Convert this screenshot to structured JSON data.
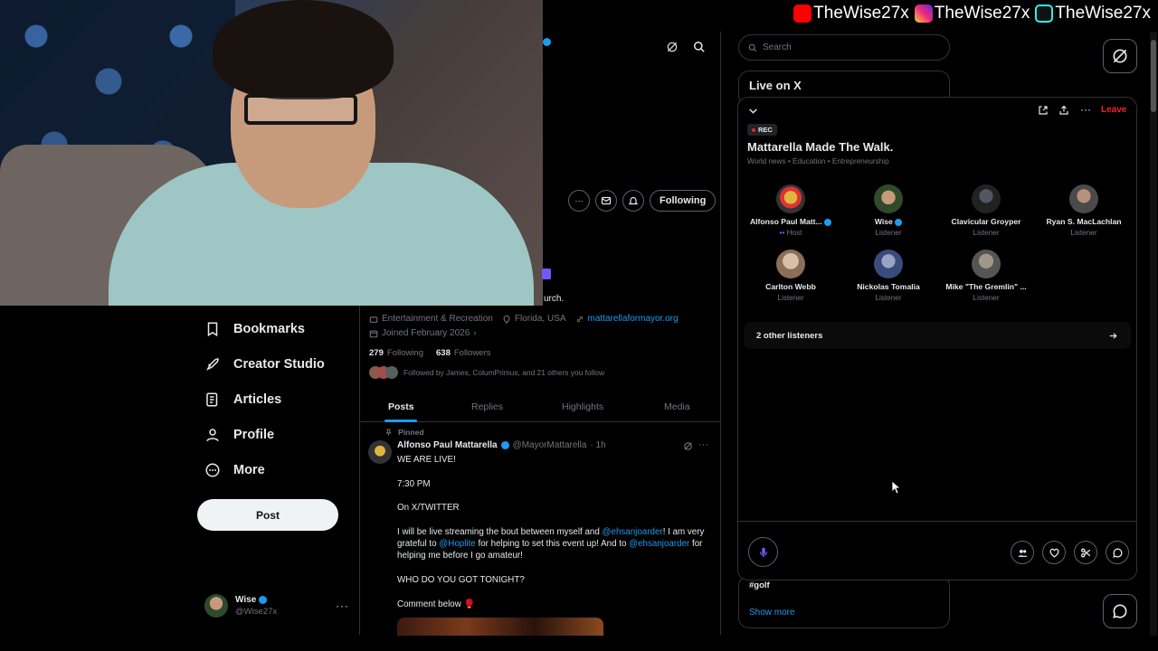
{
  "socials": [
    {
      "platform": "youtube",
      "handle": "TheWise27x",
      "icon": "youtube-icon",
      "color": "#ff0000"
    },
    {
      "platform": "instagram",
      "handle": "TheWise27x",
      "icon": "instagram-icon",
      "color": "#e1306c"
    },
    {
      "platform": "tiktok",
      "handle": "TheWise27x",
      "icon": "tiktok-icon",
      "color": "#25f4ee"
    }
  ],
  "nav": {
    "items": [
      {
        "label": "Bookmarks",
        "icon": "bookmark-icon"
      },
      {
        "label": "Creator Studio",
        "icon": "rocket-icon"
      },
      {
        "label": "Articles",
        "icon": "article-icon"
      },
      {
        "label": "Profile",
        "icon": "person-icon"
      },
      {
        "label": "More",
        "icon": "more-circle-icon"
      }
    ],
    "post_label": "Post"
  },
  "account": {
    "name": "Wise",
    "handle": "@Wise27x"
  },
  "profile": {
    "following_button": "Following",
    "bio_fragment": "urch.",
    "category": "Entertainment & Recreation",
    "location": "Florida, USA",
    "website": "mattarellaformayor.org",
    "joined": "Joined February 2026",
    "following_count": "279",
    "following_label": "Following",
    "followers_count": "638",
    "followers_label": "Followers",
    "followed_by": "Followed by James, ColumPrimus, and 21 others you follow",
    "tabs": [
      "Posts",
      "Replies",
      "Highlights",
      "Media"
    ],
    "active_tab": "Posts"
  },
  "pinned_post": {
    "pinned_label": "Pinned",
    "author": "Alfonso Paul Mattarella",
    "handle": "@MayorMattarella",
    "time": "· 1h",
    "line1": "WE ARE LIVE!",
    "line2": "7:30 PM",
    "line3": "On X/TWITTER",
    "body_a": "I will be live streaming the bout between myself and ",
    "mention1": "@ehsanjoarder",
    "body_b": "! I am very grateful to ",
    "mention2": "@Hoplite",
    "body_c": " for helping to set this event up! And to ",
    "mention3": "@ehsanjoarder",
    "body_d": " for helping me before I go amateur!",
    "line5": "WHO DO YOU GOT TONIGHT?",
    "line6": "Comment below 🥊"
  },
  "search": {
    "placeholder": "Search"
  },
  "live_card": {
    "title": "Live on X"
  },
  "trends": {
    "tag": "#golf",
    "show_more": "Show more"
  },
  "space": {
    "leave_label": "Leave",
    "rec_label": "REC",
    "title": "Mattarella Made The Walk.",
    "topics": "World news • Education • Entrepreneurship",
    "participants": [
      {
        "name": "Alfonso Paul Matt...",
        "role": "Host",
        "verified": true
      },
      {
        "name": "Wise",
        "role": "Listener",
        "verified": true
      },
      {
        "name": "Clavicular Groyper",
        "role": "Listener",
        "verified": false
      },
      {
        "name": "Ryan S. MacLachlan",
        "role": "Listener",
        "verified": false
      },
      {
        "name": "Carlton Webb",
        "role": "Listener",
        "verified": false
      },
      {
        "name": "Nickolas Tomalia",
        "role": "Listener",
        "verified": false
      },
      {
        "name": "Mike \"The Gremlin\" ...",
        "role": "Listener",
        "verified": false
      }
    ],
    "other_listeners": "2 other listeners"
  },
  "colors": {
    "accent": "#1d9bf0",
    "leave": "#f4212e",
    "mic": "#7856ff",
    "background": "#000000"
  }
}
